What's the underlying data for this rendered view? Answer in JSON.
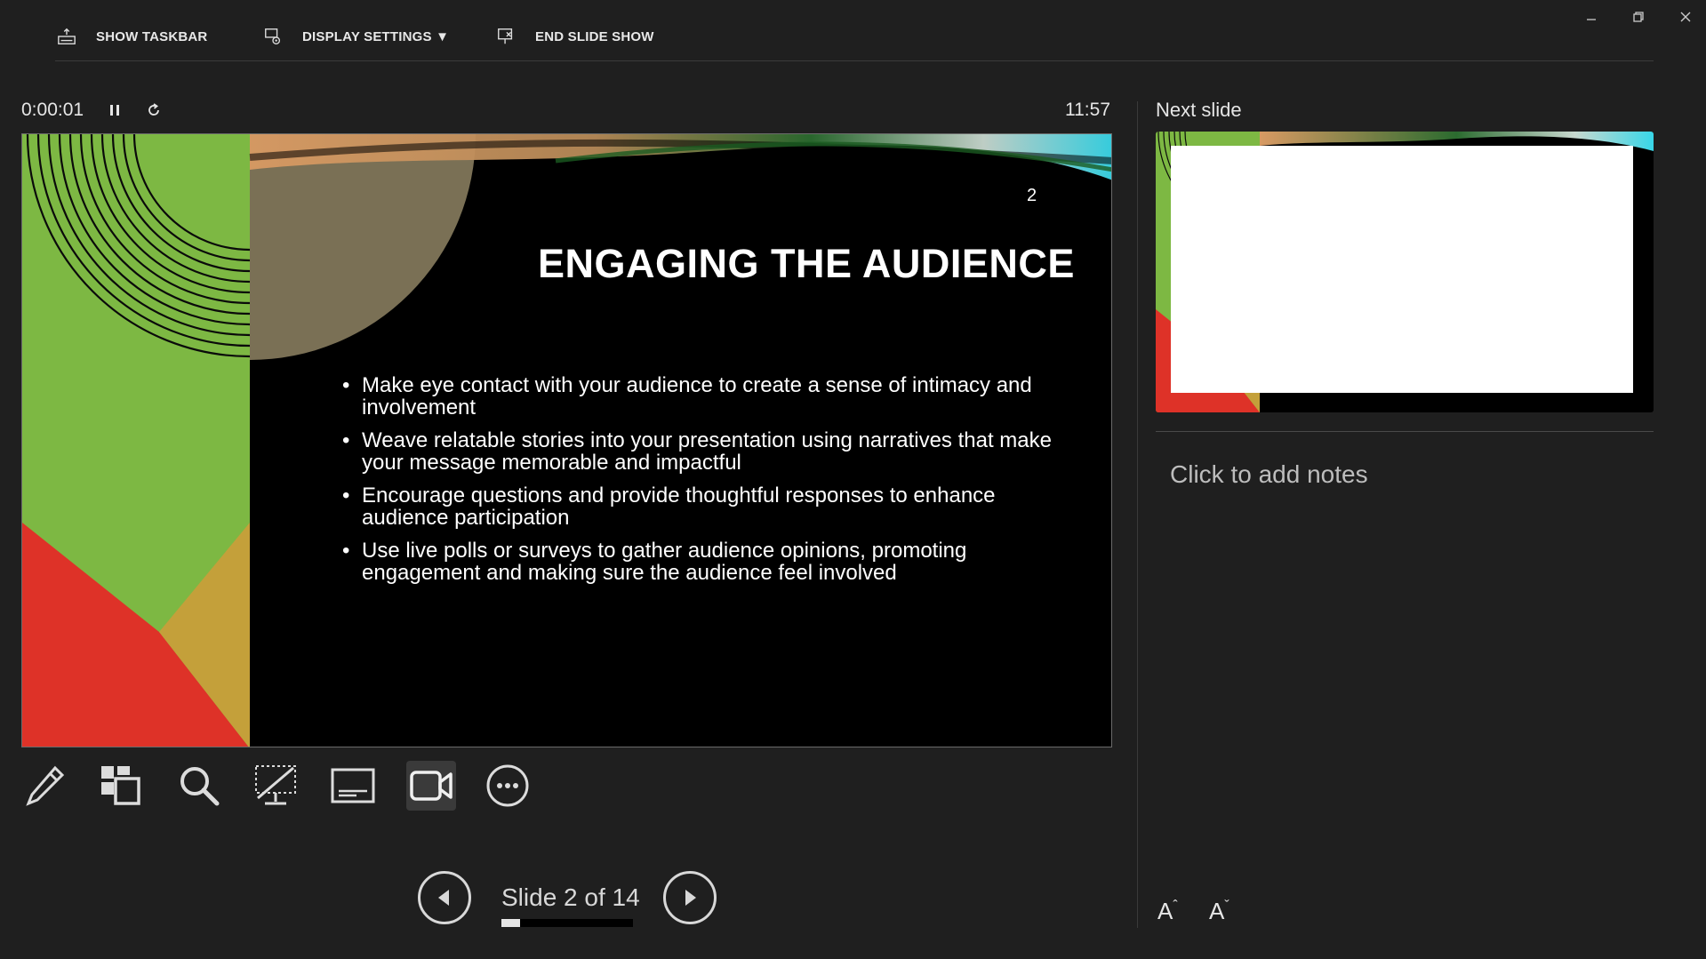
{
  "toolbar": {
    "show_taskbar": "SHOW TASKBAR",
    "display_settings": "DISPLAY SETTINGS ▼",
    "end_slide_show": "END SLIDE SHOW"
  },
  "presenter": {
    "elapsed_time": "0:00:01",
    "clock": "11:57"
  },
  "slide": {
    "number": "2",
    "title": "ENGAGING THE AUDIENCE",
    "bullets": [
      "Make eye contact with your audience to create a sense of intimacy and involvement",
      "Weave relatable stories into your presentation using narratives that make your message memorable and impactful",
      "Encourage questions and provide thoughtful responses to enhance audience participation",
      "Use live polls or surveys to gather audience opinions, promoting engagement and making sure the audience feel involved"
    ]
  },
  "tools": [
    {
      "icon": "pen-icon"
    },
    {
      "icon": "see-all-slides-icon"
    },
    {
      "icon": "zoom-icon"
    },
    {
      "icon": "black-screen-icon"
    },
    {
      "icon": "subtitles-icon"
    },
    {
      "icon": "camera-icon",
      "active": true
    },
    {
      "icon": "more-options-icon"
    }
  ],
  "navigation": {
    "slide_counter": "Slide 2 of 14",
    "current": 2,
    "total": 14
  },
  "right_pane": {
    "next_slide_label": "Next slide",
    "notes_placeholder": "Click to add notes",
    "increase_font": "A",
    "decrease_font": "A"
  },
  "colors": {
    "background": "#1f1f1f",
    "slide_green": "#7db843",
    "slide_red": "#de3228",
    "slide_gold": "#c4a03a",
    "slide_olive": "#7a7055",
    "accent_cyan": "#38d6e8"
  }
}
